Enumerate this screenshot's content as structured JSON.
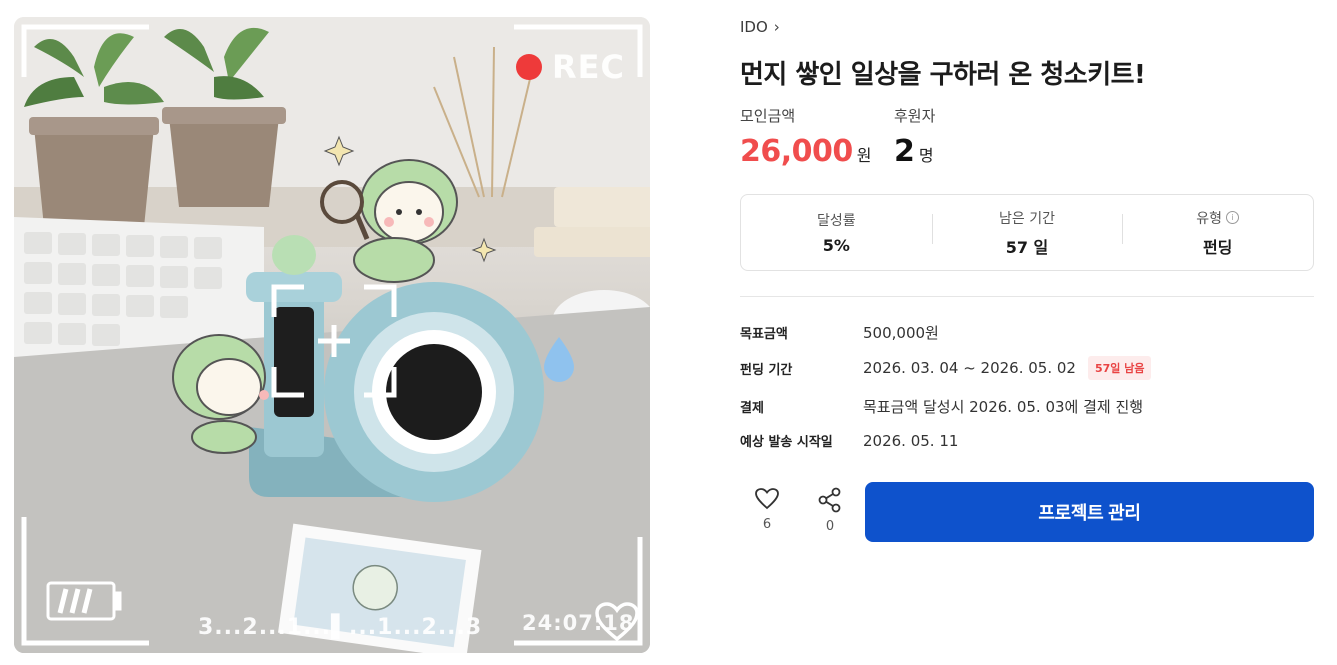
{
  "hero": {
    "rec_label": "REC",
    "scale_label": "3...2...1...▌...1...2...3",
    "time_label": "24:07:18",
    "heart_icon": "heart-outline-icon",
    "battery_icon": "battery-icon"
  },
  "project": {
    "creator": "IDO",
    "title": "먼지 쌓인 일상을 구하러 온 청소키트!",
    "amount_label": "모인금액",
    "amount_value": "26,000",
    "amount_unit": "원",
    "supporters_label": "후원자",
    "supporters_value": "2",
    "supporters_unit": "명"
  },
  "summary": {
    "achievement_label": "달성률",
    "achievement_value": "5%",
    "remaining_label": "남은 기간",
    "remaining_value": "57 일",
    "type_label": "유형",
    "type_value": "펀딩"
  },
  "details": {
    "goal_label": "목표금액",
    "goal_value": "500,000원",
    "period_label": "펀딩 기간",
    "period_value": "2026. 03. 04 ~ 2026. 05. 02",
    "period_badge": "57일 남음",
    "payment_label": "결제",
    "payment_value": "목표금액 달성시 2026. 05. 03에 결제 진행",
    "ship_label": "예상 발송 시작일",
    "ship_value": "2026. 05. 11"
  },
  "actions": {
    "like_count": "6",
    "share_count": "0",
    "manage_label": "프로젝트 관리"
  },
  "colors": {
    "accent": "#0e52cc",
    "amount": "#f04d4d",
    "badge_bg": "#fdecec",
    "badge_text": "#e94444"
  }
}
